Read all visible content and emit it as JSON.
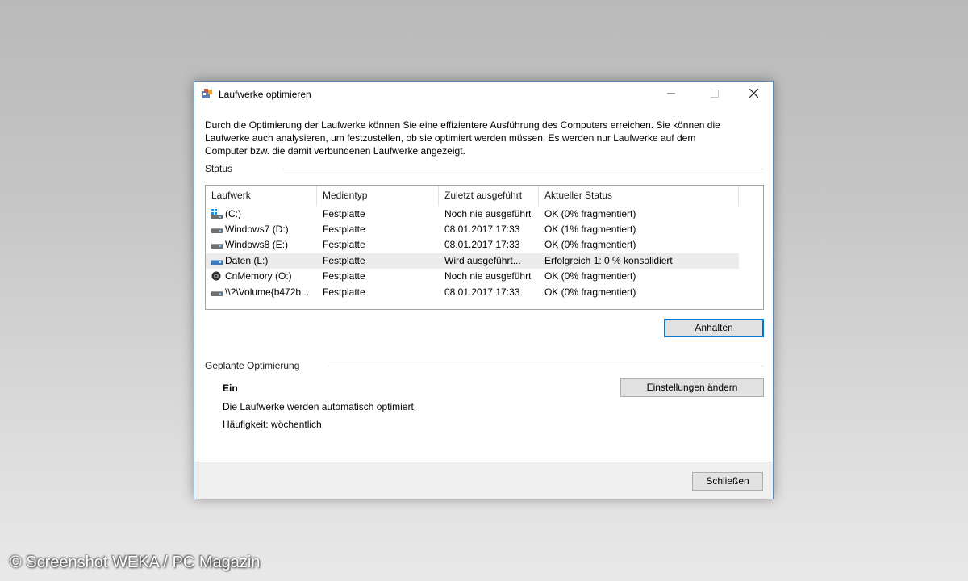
{
  "window": {
    "title": "Laufwerke optimieren",
    "controls": {
      "minimize": "–",
      "maximize": "□",
      "close": "✕"
    }
  },
  "intro_text": "Durch die Optimierung der Laufwerke können Sie eine effizientere Ausführung des Computers erreichen. Sie können die Laufwerke auch analysieren, um festzustellen, ob sie optimiert werden müssen. Es werden nur Laufwerke auf dem Computer bzw. die damit verbundenen Laufwerke angezeigt.",
  "status": {
    "section_label": "Status",
    "columns": [
      "Laufwerk",
      "Medientyp",
      "Zuletzt ausgeführt",
      "Aktueller Status"
    ],
    "drives": [
      {
        "name": "(C:)",
        "media": "Festplatte",
        "last_run": "Noch nie ausgeführt",
        "status": "OK (0% fragmentiert)",
        "icon": "windows-drive-icon",
        "selected": false
      },
      {
        "name": "Windows7 (D:)",
        "media": "Festplatte",
        "last_run": "08.01.2017 17:33",
        "status": "OK (1% fragmentiert)",
        "icon": "hard-drive-icon",
        "selected": false
      },
      {
        "name": "Windows8 (E:)",
        "media": "Festplatte",
        "last_run": "08.01.2017 17:33",
        "status": "OK (0% fragmentiert)",
        "icon": "hard-drive-icon",
        "selected": false
      },
      {
        "name": "Daten (L:)",
        "media": "Festplatte",
        "last_run": "Wird ausgeführt...",
        "status": "Erfolgreich 1: 0 % konsolidiert",
        "icon": "hard-drive-icon",
        "selected": true
      },
      {
        "name": "CnMemory (O:)",
        "media": "Festplatte",
        "last_run": "Noch nie ausgeführt",
        "status": "OK (0% fragmentiert)",
        "icon": "removable-disk-icon",
        "selected": false
      },
      {
        "name": "\\\\?\\Volume{b472b...",
        "media": "Festplatte",
        "last_run": "08.01.2017 17:33",
        "status": "OK (0% fragmentiert)",
        "icon": "hard-drive-icon",
        "selected": false
      }
    ],
    "stop_button": "Anhalten"
  },
  "schedule": {
    "section_label": "Geplante Optimierung",
    "state": "Ein",
    "description": "Die Laufwerke werden automatisch optimiert.",
    "frequency": "Häufigkeit: wöchentlich",
    "settings_button": "Einstellungen ändern"
  },
  "footer": {
    "close_button": "Schließen"
  },
  "watermark": "© Screenshot WEKA / PC Magazin",
  "colors": {
    "accent": "#0078d7",
    "selected_row": "#ececec",
    "window_border": "#5b86b8"
  }
}
